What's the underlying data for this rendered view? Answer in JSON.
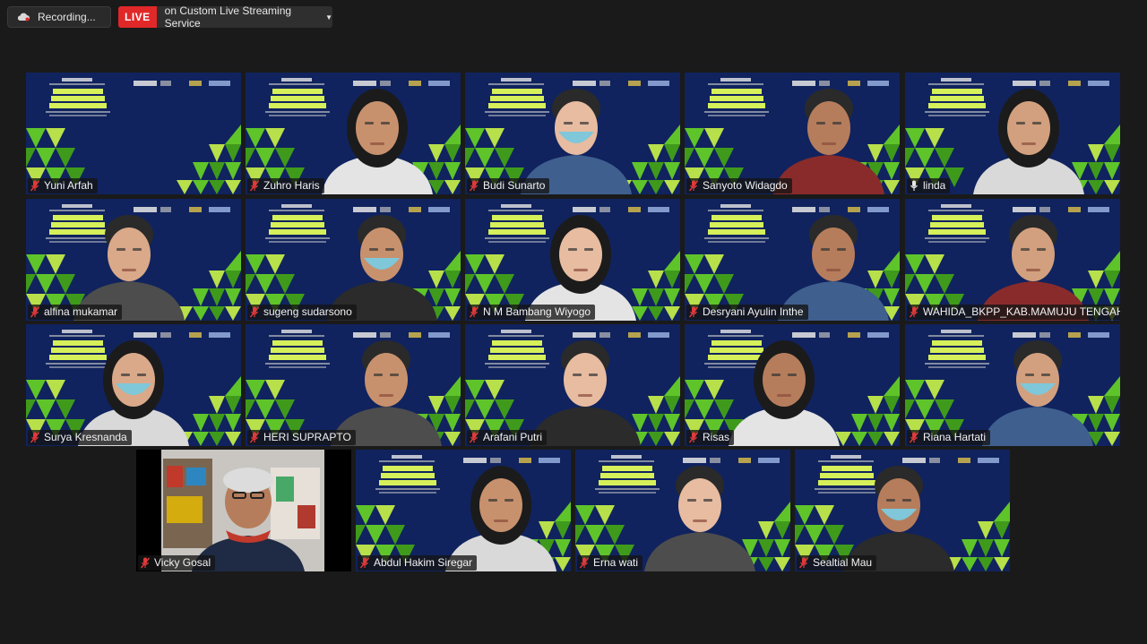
{
  "toolbar": {
    "recording_label": "Recording...",
    "live_badge": "LIVE",
    "live_service": "on Custom Live Streaming Service"
  },
  "colors": {
    "tile_bg": "#10235e",
    "triangle_green": "#5fc42a",
    "active_border": "#d8e57a",
    "live_red": "#e02828"
  },
  "participants": [
    {
      "name": "Yuni Arfah",
      "muted": true,
      "video": "banner"
    },
    {
      "name": "Zuhro Haris",
      "muted": true,
      "video": "person"
    },
    {
      "name": "Budi Sunarto",
      "muted": true,
      "video": "person"
    },
    {
      "name": "Sanyoto Widagdo",
      "muted": true,
      "video": "person"
    },
    {
      "name": "linda",
      "muted": false,
      "video": "person",
      "active_speaker": true
    },
    {
      "name": "alfina mukamar",
      "muted": true,
      "video": "person"
    },
    {
      "name": "sugeng sudarsono",
      "muted": true,
      "video": "person"
    },
    {
      "name": "N M Bambang Wiyogo",
      "muted": true,
      "video": "person"
    },
    {
      "name": "Desryani Ayulin Inthe",
      "muted": true,
      "video": "person"
    },
    {
      "name": "WAHIDA_BKPP_KAB.MAMUJU TENGAH",
      "muted": true,
      "video": "person"
    },
    {
      "name": "Surya Kresnanda",
      "muted": true,
      "video": "person"
    },
    {
      "name": "HERI SUPRAPTO",
      "muted": true,
      "video": "person"
    },
    {
      "name": "Arafani Putri",
      "muted": true,
      "video": "person"
    },
    {
      "name": "Risas",
      "muted": true,
      "video": "person"
    },
    {
      "name": "Riana Hartati",
      "muted": true,
      "video": "person"
    },
    {
      "name": "Vicky Gosal",
      "muted": true,
      "video": "room"
    },
    {
      "name": "Abdul Hakim Siregar",
      "muted": true,
      "video": "person"
    },
    {
      "name": "Erna wati",
      "muted": true,
      "video": "person"
    },
    {
      "name": "Sealtial Mau",
      "muted": true,
      "video": "person"
    }
  ]
}
